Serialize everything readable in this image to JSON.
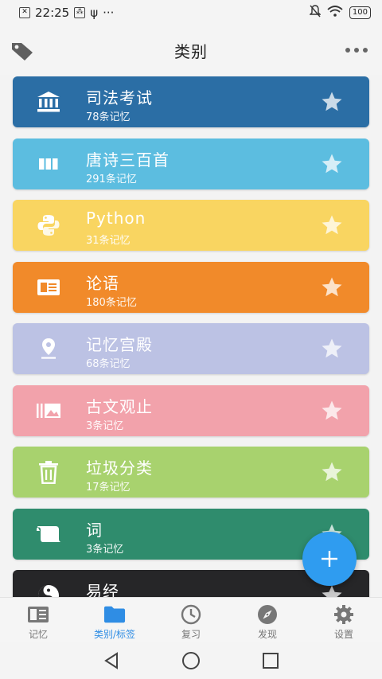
{
  "status_bar": {
    "time": "22:25",
    "battery": "100"
  },
  "header": {
    "title": "类别"
  },
  "colors": {
    "accent": "#2f9cf0",
    "nav_active": "#2f8de4"
  },
  "categories": [
    {
      "name": "司法考试",
      "count": "78条记忆",
      "color": "#2b6ea5",
      "icon": "bank-icon"
    },
    {
      "name": "唐诗三百首",
      "count": "291条记忆",
      "color": "#5cbde0",
      "icon": "columns-icon"
    },
    {
      "name": "Python",
      "count": "31条记忆",
      "color": "#f9d561",
      "icon": "python-icon"
    },
    {
      "name": "论语",
      "count": "180条记忆",
      "color": "#f18a2a",
      "icon": "id-card-icon"
    },
    {
      "name": "记忆宫殿",
      "count": "68条记忆",
      "color": "#bcc2e4",
      "icon": "location-pin-icon"
    },
    {
      "name": "古文观止",
      "count": "3条记忆",
      "color": "#f2a2ab",
      "icon": "photo-library-icon"
    },
    {
      "name": "垃圾分类",
      "count": "17条记忆",
      "color": "#a8d26e",
      "icon": "trash-icon"
    },
    {
      "name": "词",
      "count": "3条记忆",
      "color": "#2f8c6d",
      "icon": "scroll-icon"
    },
    {
      "name": "易经",
      "count": "",
      "color": "#262628",
      "icon": "yin-yang-icon"
    }
  ],
  "bottom_nav": [
    {
      "label": "记忆",
      "icon": "memo-icon"
    },
    {
      "label": "类别/标签",
      "icon": "folder-icon"
    },
    {
      "label": "复习",
      "icon": "clock-icon"
    },
    {
      "label": "发现",
      "icon": "compass-icon"
    },
    {
      "label": "设置",
      "icon": "gear-icon"
    }
  ]
}
